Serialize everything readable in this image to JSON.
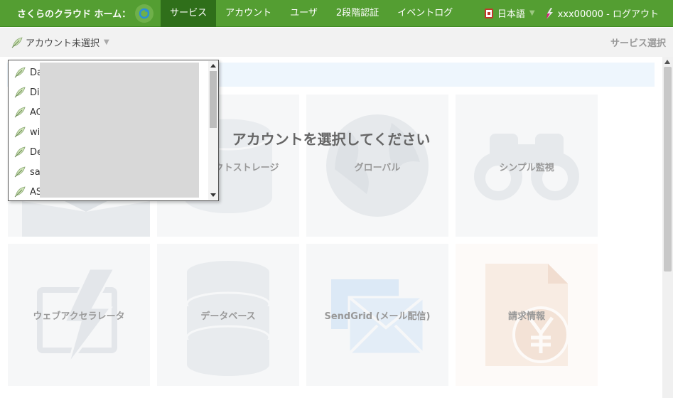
{
  "header": {
    "brand": "さくらのクラウド ホーム：",
    "nav": [
      {
        "label": "サービス",
        "active": true
      },
      {
        "label": "アカウント",
        "active": false
      },
      {
        "label": "ユーザ",
        "active": false
      },
      {
        "label": "2段階認証",
        "active": false
      },
      {
        "label": "イベントログ",
        "active": false
      }
    ],
    "language": "日本語",
    "user": "xxx00000 - ログアウト",
    "colors": {
      "bar": "#549e32",
      "active": "#2f6f1a"
    }
  },
  "subbar": {
    "account_select": "アカウント未選択",
    "service_select": "サービス選択"
  },
  "overlay_message": "アカウントを選択してください",
  "tiles": [
    {
      "label": "",
      "icon": "box-icon"
    },
    {
      "label": "オブジェクトストレージ",
      "icon": "storage-icon"
    },
    {
      "label": "グローバル",
      "icon": "globe-icon"
    },
    {
      "label": "シンプル監視",
      "icon": "binoculars-icon"
    },
    {
      "label": "ウェブアクセラレータ",
      "icon": "lightning-icon"
    },
    {
      "label": "データベース",
      "icon": "database-icon"
    },
    {
      "label": "SendGrid (メール配信)",
      "icon": "envelope-icon"
    },
    {
      "label": "請求情報",
      "icon": "yen-document-icon"
    }
  ],
  "dropdown": {
    "items": [
      "Da",
      "Dis",
      "AC",
      "wi",
      "De",
      "sa",
      "AS"
    ]
  }
}
